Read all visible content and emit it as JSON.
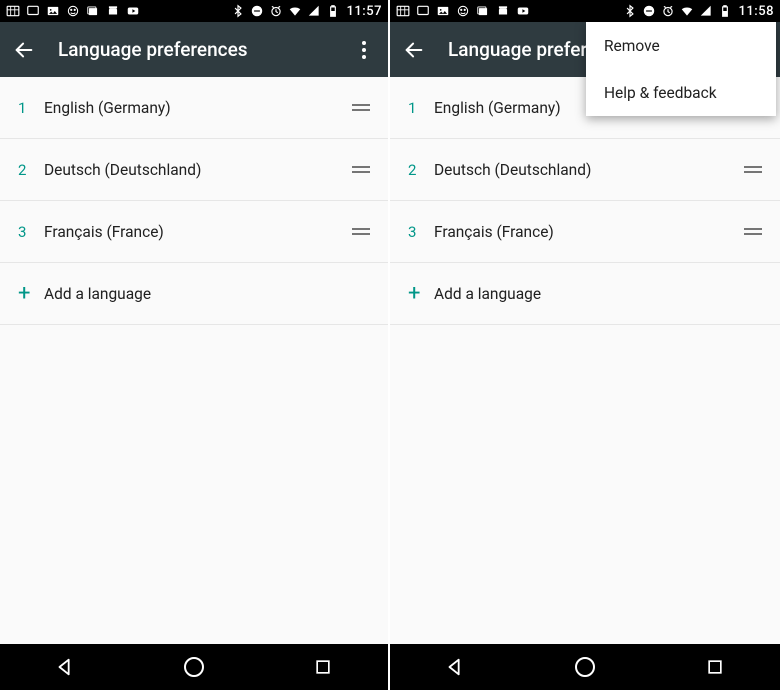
{
  "screens": [
    {
      "status_time": "11:57",
      "toolbar_title": "Language preferences",
      "menu_open": false
    },
    {
      "status_time": "11:58",
      "toolbar_title": "Language preferences",
      "menu_open": true
    }
  ],
  "languages": [
    {
      "index": "1",
      "name": "English (Germany)"
    },
    {
      "index": "2",
      "name": "Deutsch (Deutschland)"
    },
    {
      "index": "3",
      "name": "Français (France)"
    }
  ],
  "add_label": "Add a language",
  "menu_items": [
    {
      "label": "Remove"
    },
    {
      "label": "Help & feedback"
    }
  ],
  "colors": {
    "accent": "#009688",
    "toolbar": "#2f3b40"
  }
}
